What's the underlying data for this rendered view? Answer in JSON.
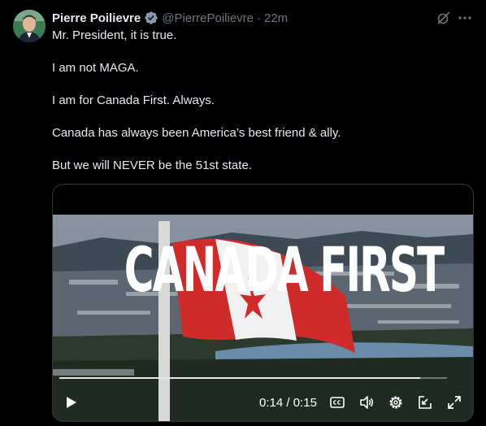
{
  "tweet": {
    "author_name": "Pierre Poilievre",
    "handle": "@PierrePoilievre",
    "separator": "·",
    "time": "22m",
    "icons": [
      "verified-badge-icon",
      "grok-icon",
      "more-icon"
    ],
    "paragraphs": [
      "Mr. President, it is true.",
      "I am not MAGA.",
      "I am for Canada First. Always.",
      "Canada has always been America’s best friend & ally.",
      "But we will NEVER be the 51st state."
    ]
  },
  "video": {
    "overlay_text": "CANADA FIRST",
    "current_time": "0:14",
    "time_separator": "/",
    "duration": "0:15",
    "progress": 0.93,
    "controls": [
      "play-icon",
      "captions-icon",
      "volume-icon",
      "settings-icon",
      "pip-icon",
      "fullscreen-icon"
    ]
  },
  "colors": {
    "background": "#000000",
    "text": "#e7e9ea",
    "muted": "#71767b",
    "verified": "#829aab"
  }
}
